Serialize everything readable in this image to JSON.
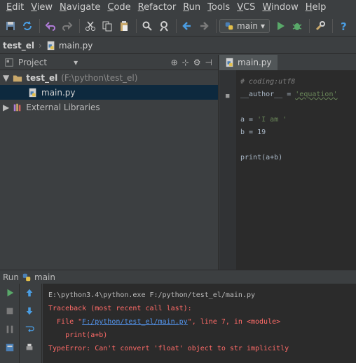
{
  "menu": [
    "Edit",
    "View",
    "Navigate",
    "Code",
    "Refactor",
    "Run",
    "Tools",
    "VCS",
    "Window",
    "Help"
  ],
  "toolbar": {
    "run_config": "main"
  },
  "breadcrumb": {
    "project": "test_el",
    "file": "main.py"
  },
  "project_panel": {
    "title": "Project",
    "root_label": "test_el",
    "root_path": "(F:\\python\\test_el)",
    "file": "main.py",
    "external": "External Libraries"
  },
  "editor": {
    "tab": "main.py",
    "lines": {
      "l1": "# coding:utf8",
      "l2_a": "__author__ = ",
      "l2_b": "'equation'",
      "l4_a": "a = ",
      "l4_b": "'I am '",
      "l5": "b = 19",
      "l7": "print(a+b)"
    }
  },
  "run": {
    "label": "Run",
    "config": "main",
    "console": {
      "cmd": "E:\\python3.4\\python.exe F:/python/test_el/main.py",
      "tb1": "Traceback (most recent call last):",
      "tb2_a": "  File \"",
      "tb2_link": "F:/python/test_el/main.py",
      "tb2_b": "\", line 7, in <module>",
      "tb3": "    print(a+b)",
      "tb4": "TypeError: Can't convert 'float' object to str implicitly"
    }
  },
  "colors": {
    "accent_run": "#59a869",
    "error": "#ff6b68",
    "string": "#6a8759"
  }
}
